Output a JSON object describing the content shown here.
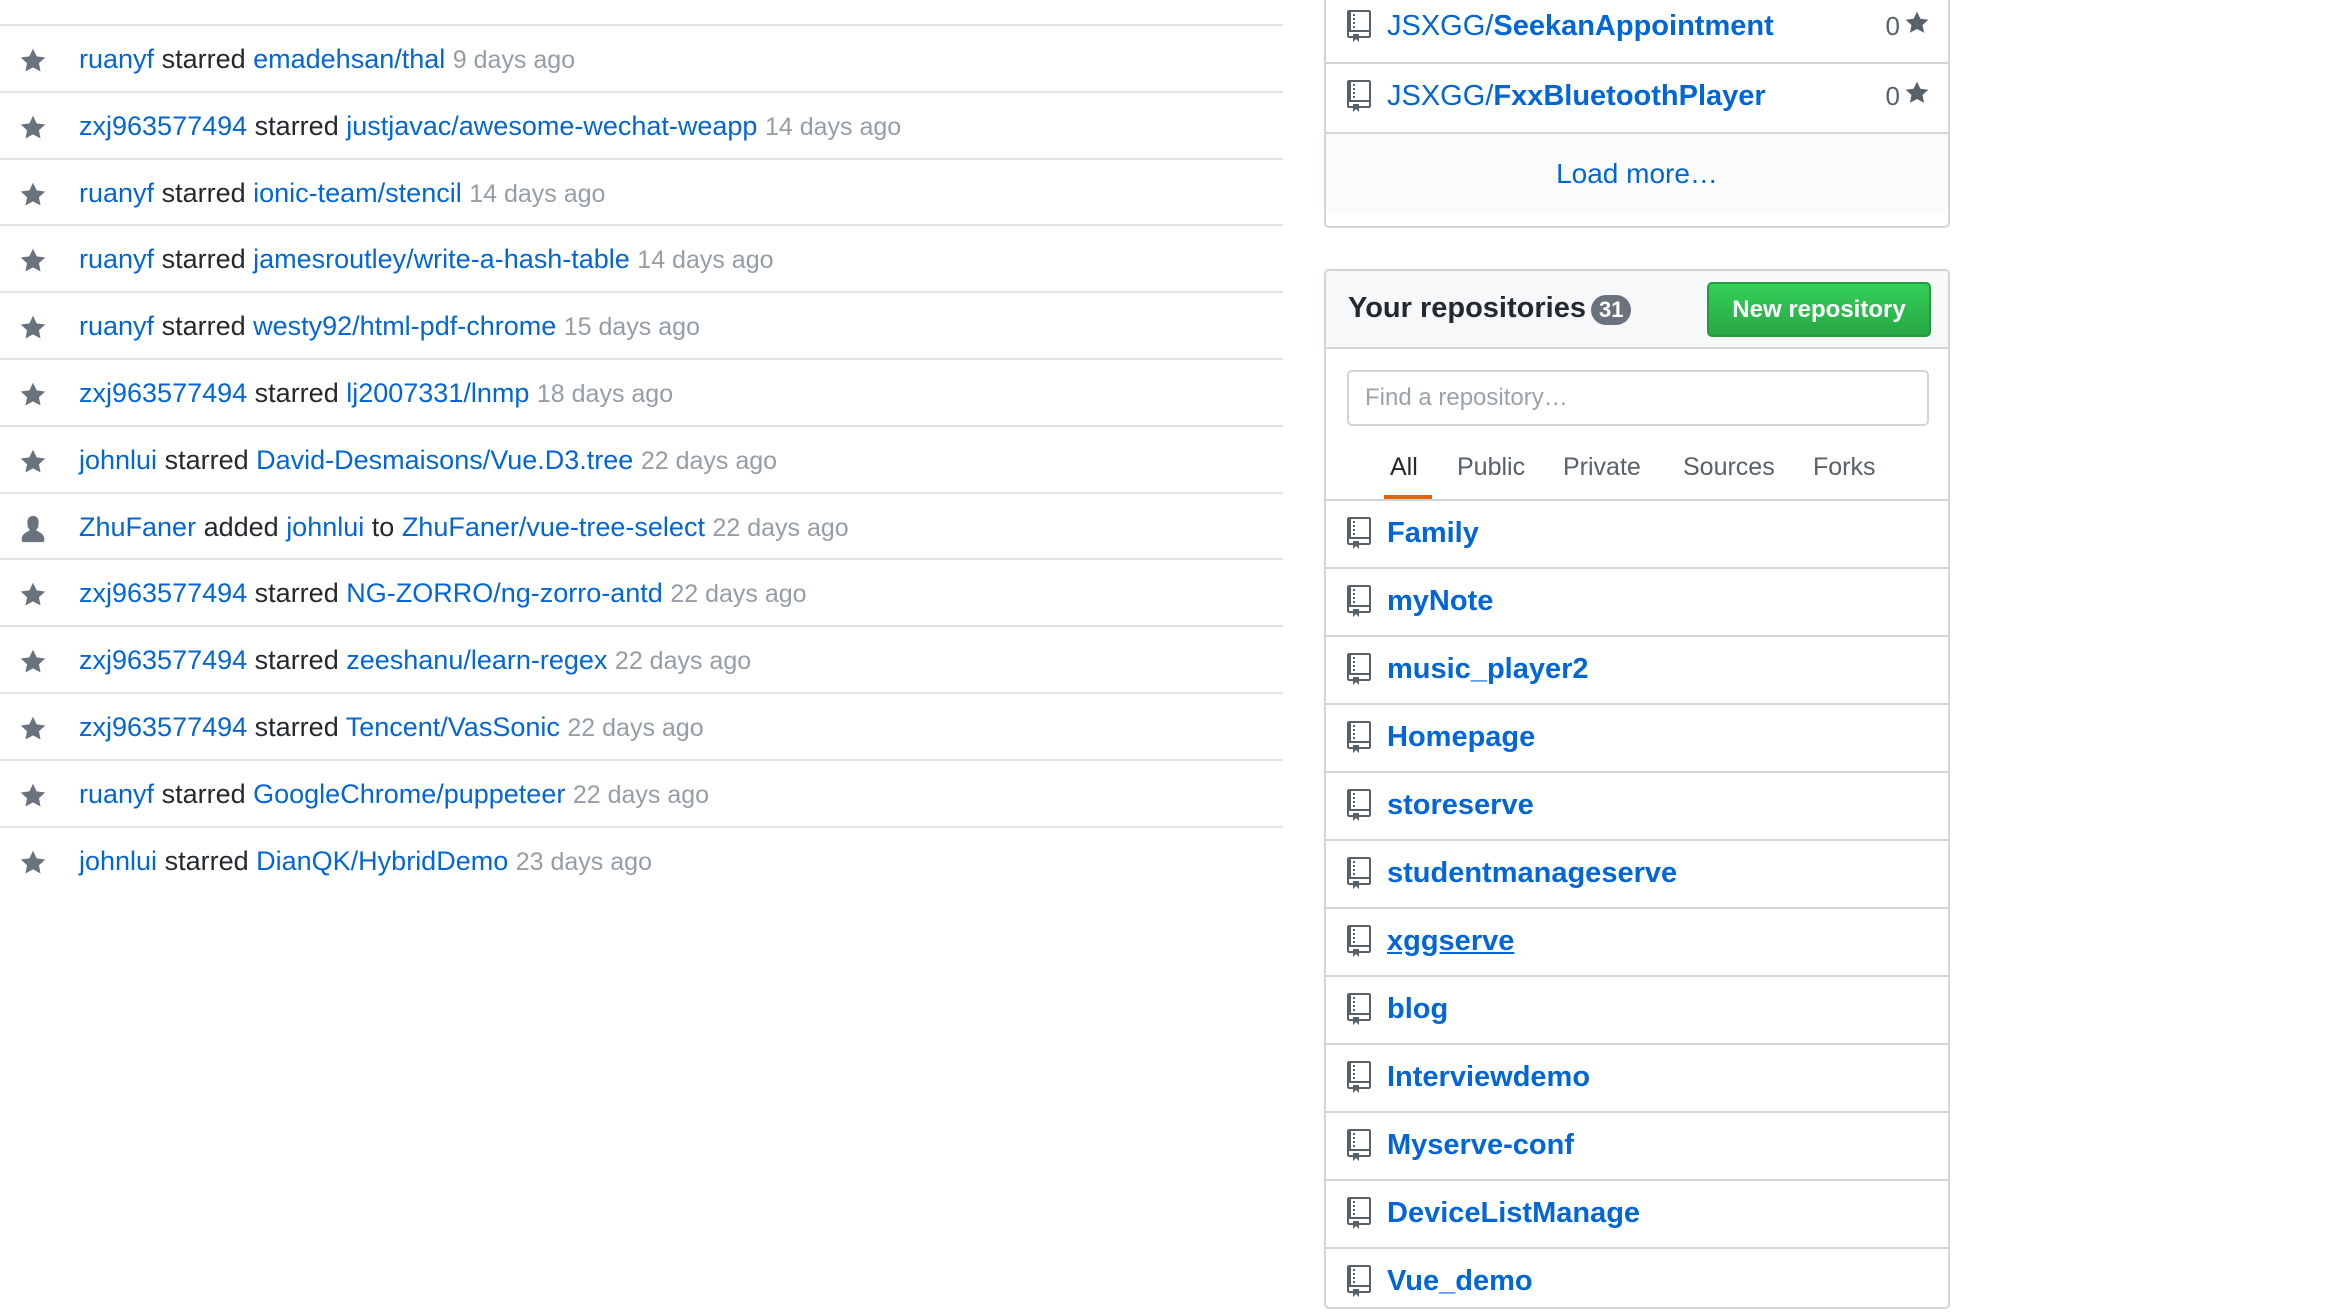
{
  "feed": {
    "items": [
      {
        "actor": "ruanyf",
        "verb": "starred",
        "target": "emadehsan/thal",
        "time": "9 days ago",
        "icon": "star-icon"
      },
      {
        "actor": "zxj963577494",
        "verb": "starred",
        "target": "justjavac/awesome-wechat-weapp",
        "time": "14 days ago",
        "icon": "star-icon"
      },
      {
        "actor": "ruanyf",
        "verb": "starred",
        "target": "ionic-team/stencil",
        "time": "14 days ago",
        "icon": "star-icon"
      },
      {
        "actor": "ruanyf",
        "verb": "starred",
        "target": "jamesroutley/write-a-hash-table",
        "time": "14 days ago",
        "icon": "star-icon"
      },
      {
        "actor": "ruanyf",
        "verb": "starred",
        "target": "westy92/html-pdf-chrome",
        "time": "15 days ago",
        "icon": "star-icon"
      },
      {
        "actor": "zxj963577494",
        "verb": "starred",
        "target": "lj2007331/lnmp",
        "time": "18 days ago",
        "icon": "star-icon"
      },
      {
        "actor": "johnlui",
        "verb": "starred",
        "target": "David-Desmaisons/Vue.D3.tree",
        "time": "22 days ago",
        "icon": "star-icon"
      },
      {
        "actor": "ZhuFaner",
        "verb": "added",
        "object": "johnlui",
        "prep": "to",
        "target": "ZhuFaner/vue-tree-select",
        "time": "22 days ago",
        "icon": "person-icon"
      },
      {
        "actor": "zxj963577494",
        "verb": "starred",
        "target": "NG-ZORRO/ng-zorro-antd",
        "time": "22 days ago",
        "icon": "star-icon"
      },
      {
        "actor": "zxj963577494",
        "verb": "starred",
        "target": "zeeshanu/learn-regex",
        "time": "22 days ago",
        "icon": "star-icon"
      },
      {
        "actor": "zxj963577494",
        "verb": "starred",
        "target": "Tencent/VasSonic",
        "time": "22 days ago",
        "icon": "star-icon"
      },
      {
        "actor": "ruanyf",
        "verb": "starred",
        "target": "GoogleChrome/puppeteer",
        "time": "22 days ago",
        "icon": "star-icon"
      },
      {
        "actor": "johnlui",
        "verb": "starred",
        "target": "DianQK/HybridDemo",
        "time": "23 days ago",
        "icon": "star-icon"
      }
    ]
  },
  "starred_box": {
    "items": [
      {
        "owner": "JSXGG/",
        "name": "SeekanAppointment",
        "stars": "0"
      },
      {
        "owner": "JSXGG/",
        "name": "FxxBluetoothPlayer",
        "stars": "0"
      }
    ],
    "load_more": "Load more…"
  },
  "repos": {
    "title": "Your repositories",
    "count": "31",
    "new_button": "New repository",
    "search_placeholder": "Find a repository…",
    "tabs": [
      "All",
      "Public",
      "Private",
      "Sources",
      "Forks"
    ],
    "active_tab": "All",
    "items": [
      "Family",
      "myNote",
      "music_player2",
      "Homepage",
      "storeserve",
      "studentmanageserve",
      "xggserve",
      "blog",
      "Interviewdemo",
      "Myserve-conf",
      "DeviceListManage",
      "Vue_demo"
    ]
  },
  "colors": {
    "link": "#0366d6",
    "muted": "#959da5",
    "accent": "#e36209",
    "button": "#28a745"
  }
}
